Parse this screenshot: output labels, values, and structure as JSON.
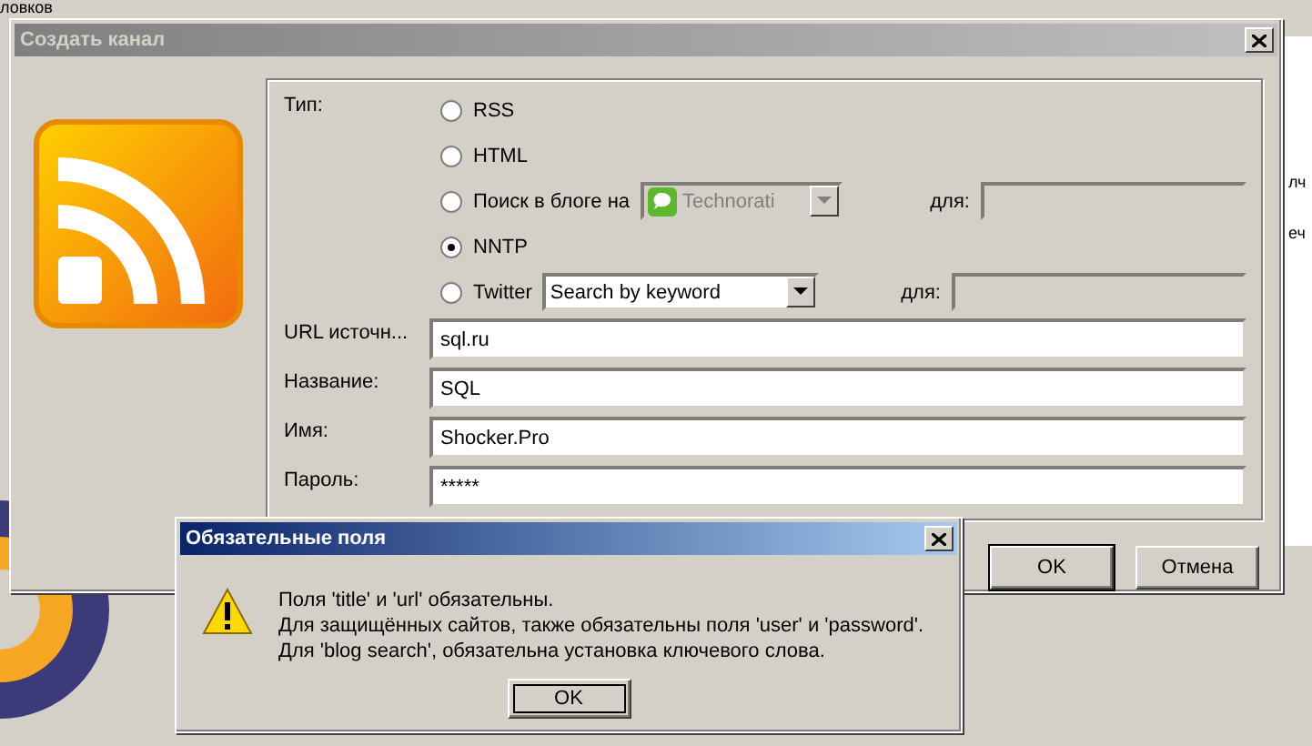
{
  "background": {
    "fragments": [
      "ловков",
      "лч",
      "еч"
    ]
  },
  "dialog": {
    "title": "Создать канал",
    "type_label": "Тип:",
    "sources": [
      {
        "kind": "plain",
        "label": "RSS",
        "selected": false
      },
      {
        "kind": "plain",
        "label": "HTML",
        "selected": false
      },
      {
        "kind": "search",
        "label": "Поиск в блоге на",
        "selected": false,
        "dropdown": {
          "value": "Technorati",
          "disabled": true
        },
        "for_label": "для:",
        "for_disabled": true
      },
      {
        "kind": "plain",
        "label": "NNTP",
        "selected": true
      },
      {
        "kind": "search",
        "label": "Twitter",
        "selected": false,
        "dropdown": {
          "value": "Search by keyword",
          "disabled": false
        },
        "for_label": "для:",
        "for_disabled": true
      }
    ],
    "fields": [
      {
        "label": "URL источн...",
        "value": "sql.ru"
      },
      {
        "label": "Название:",
        "value": "SQL"
      },
      {
        "label": "Имя:",
        "value": "Shocker.Pro"
      },
      {
        "label": "Пароль:",
        "value": "*****"
      }
    ],
    "buttons": [
      "OK",
      "Отмена"
    ]
  },
  "alert": {
    "title": "Обязательные поля",
    "lines": [
      "Поля 'title' и 'url' обязательны.",
      "Для защищённых сайтов, также обязательны поля 'user' и 'password'.",
      "Для 'blog search', обязательна установка ключевого слова."
    ],
    "button": "OK"
  }
}
